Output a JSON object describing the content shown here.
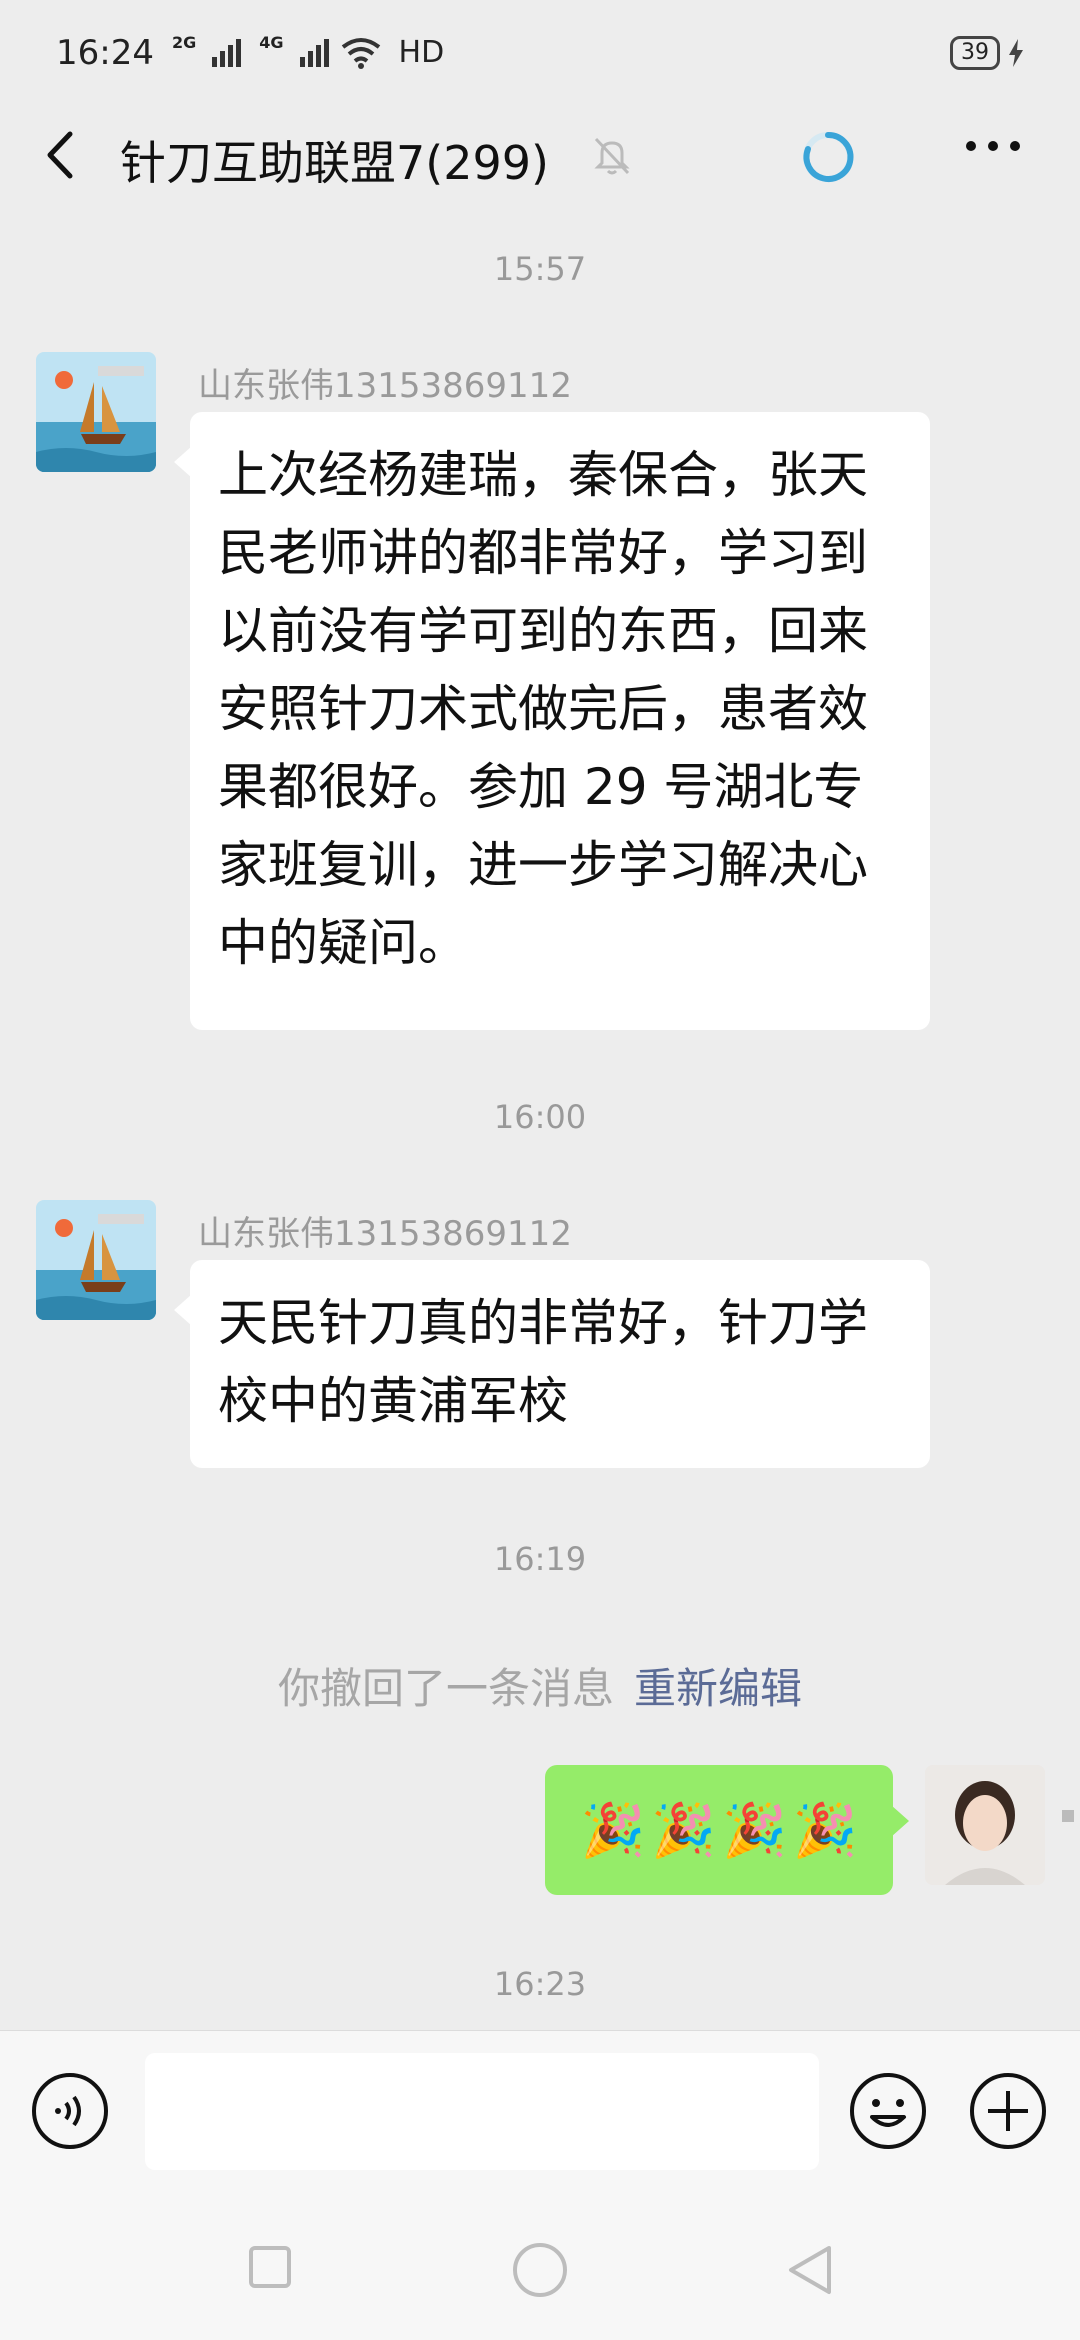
{
  "status_bar": {
    "time": "16:24",
    "network_1": "2G",
    "network_2": "4G",
    "hd": "HD",
    "battery": "39"
  },
  "header": {
    "title": "针刀互助联盟7(299)"
  },
  "messages": {
    "time_1": "15:57",
    "sender_1": "山东张伟13153869112",
    "text_1": "上次经杨建瑞，秦保合，张天民老师讲的都非常好，学习到以前没有学可到的东西，回来安照针刀术式做完后，患者效果都很好。参加 29 号湖北专家班复训，进一步学习解决心中的疑问。",
    "time_2": "16:00",
    "sender_2": "山东张伟13153869112",
    "text_2": "天民针刀真的非常好，针刀学校中的黄浦军校",
    "time_3": "16:19",
    "recall_text": "你撤回了一条消息",
    "recall_edit": "重新编辑",
    "my_message_emojis": [
      "🎉",
      "🎉",
      "🎉",
      "🎉"
    ],
    "time_4": "16:23"
  },
  "input": {
    "placeholder": ""
  },
  "colors": {
    "background": "#ededed",
    "my_bubble": "#95ec69",
    "link": "#5b6b96",
    "loading_accent": "#3aa4d8"
  }
}
